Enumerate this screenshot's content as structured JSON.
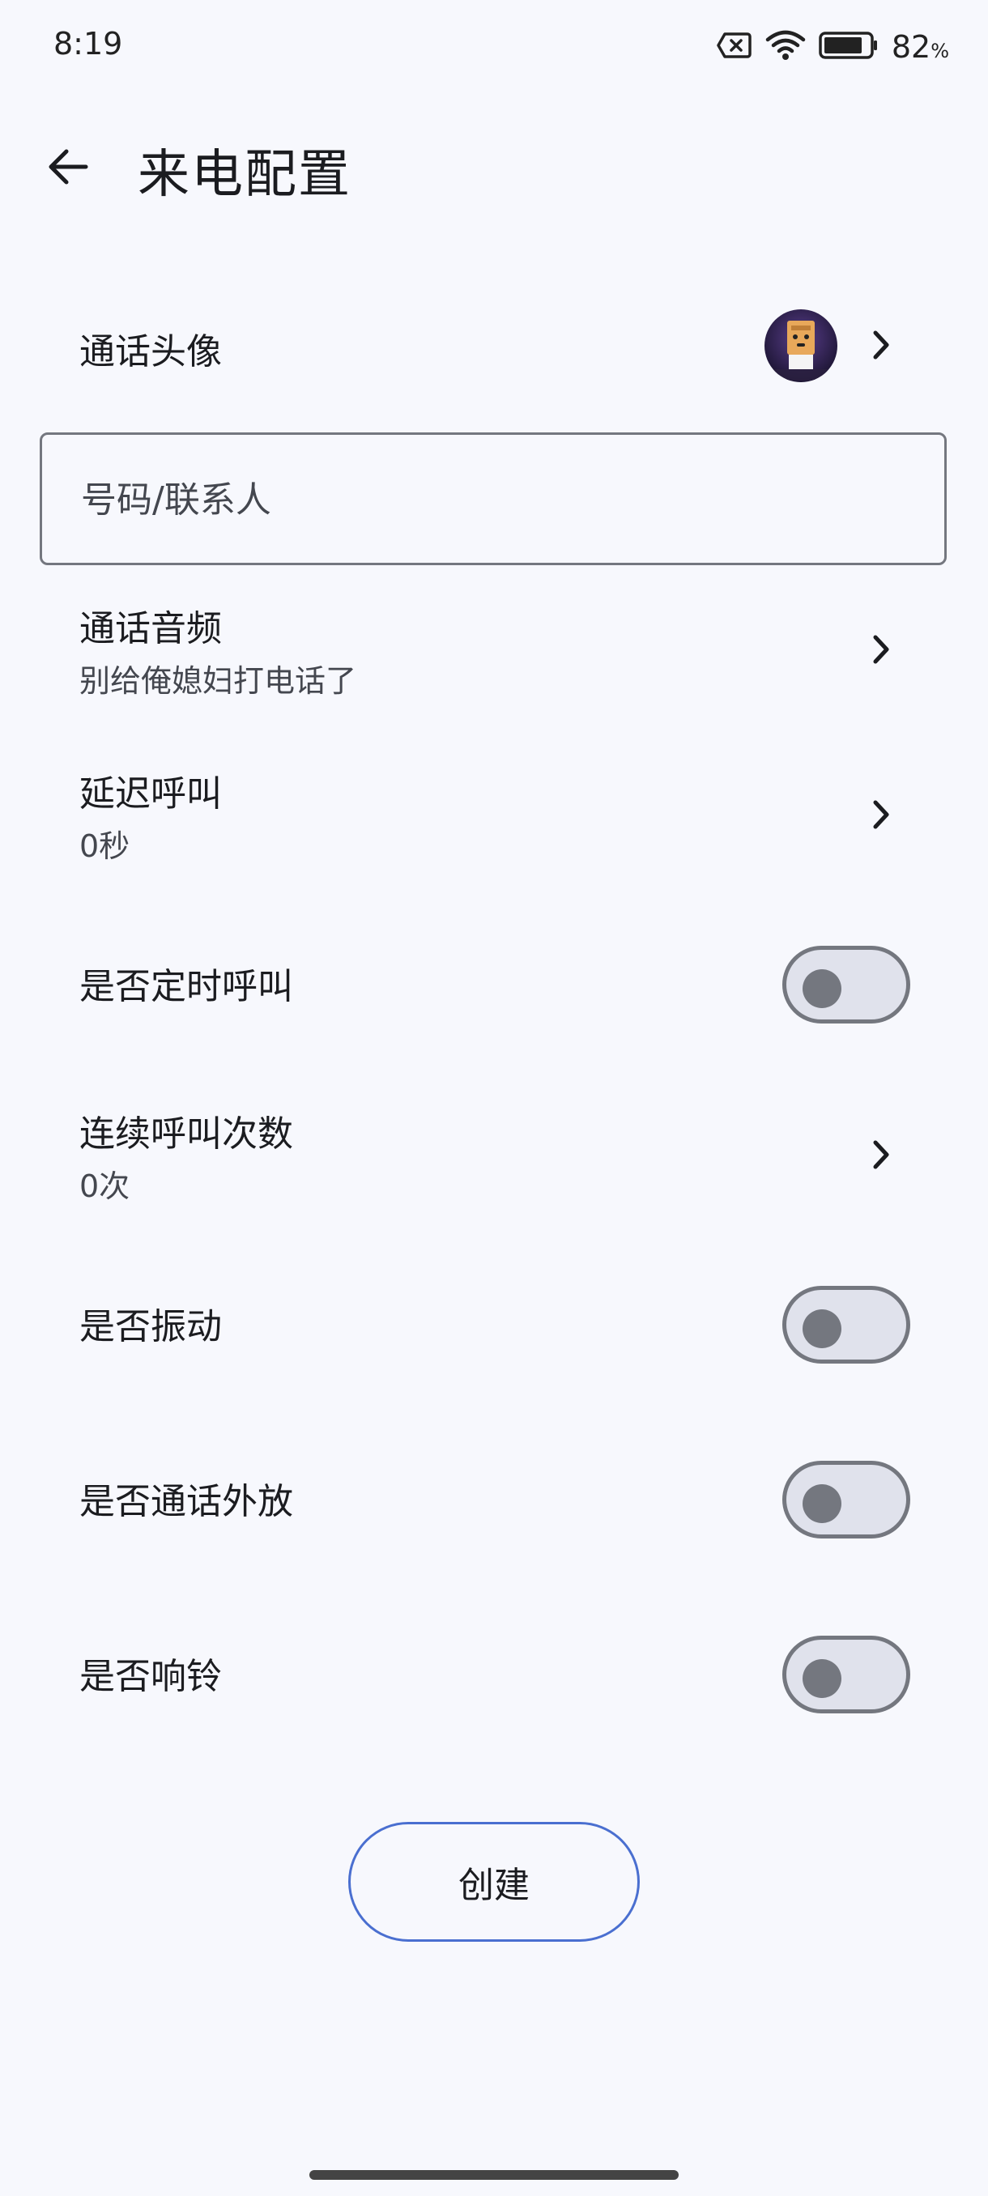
{
  "status_bar": {
    "time": "8:19",
    "battery_value": "82",
    "battery_unit": "%",
    "icons": [
      "sim-error-icon",
      "wifi-icon",
      "battery-icon"
    ]
  },
  "app_bar": {
    "title": "来电配置",
    "back_icon": "arrow-left-icon"
  },
  "form": {
    "call_avatar": {
      "label": "通话头像"
    },
    "number_field": {
      "placeholder": "号码/联系人",
      "value": ""
    },
    "call_audio": {
      "label": "通话音频",
      "value": "别给俺媳妇打电话了"
    },
    "delay_call": {
      "label": "延迟呼叫",
      "value": "0秒"
    },
    "scheduled_call": {
      "label": "是否定时呼叫",
      "enabled": false
    },
    "repeat_count": {
      "label": "连续呼叫次数",
      "value": "0次"
    },
    "vibrate": {
      "label": "是否振动",
      "enabled": false
    },
    "speaker": {
      "label": "是否通话外放",
      "enabled": false
    },
    "ring": {
      "label": "是否响铃",
      "enabled": false
    }
  },
  "actions": {
    "create_label": "创建"
  },
  "colors": {
    "background": "#f7f8fd",
    "accent_outline": "#4a6fd0",
    "toggle_off_track": "#e0e2ec",
    "toggle_off_border": "#74777f"
  }
}
